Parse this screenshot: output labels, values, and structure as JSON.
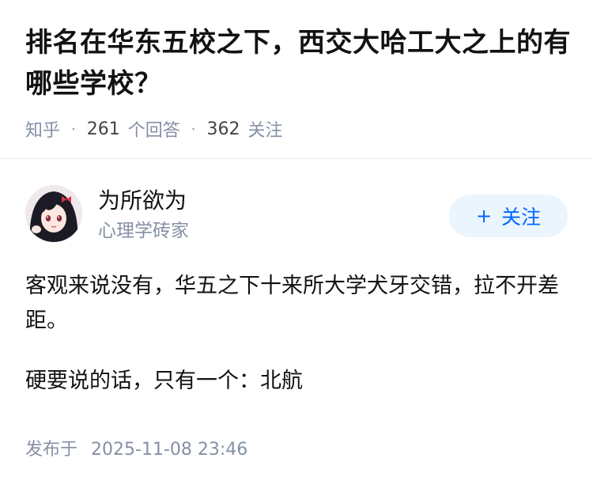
{
  "question": {
    "title": "排名在华东五校之下，西交大哈工大之上的有哪些学校？",
    "source": "知乎",
    "answer_count": "261",
    "answer_label": "个回答",
    "follower_count": "362",
    "follower_label": "关注"
  },
  "author": {
    "name": "为所欲为",
    "bio": "心理学砖家",
    "follow_icon": "+",
    "follow_label": "关注",
    "accent_color": "#0066ff"
  },
  "answer": {
    "paragraphs": [
      "客观来说没有，华五之下十来所大学犬牙交错，拉不开差距。",
      "硬要说的话，只有一个：北航"
    ],
    "publish_label": "发布于",
    "publish_time": "2025-11-08 23:46"
  }
}
